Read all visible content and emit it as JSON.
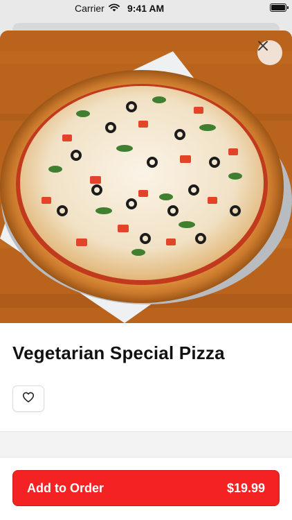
{
  "status_bar": {
    "carrier": "Carrier",
    "time": "9:41 AM",
    "wifi_icon": "wifi-icon",
    "battery_icon": "battery-icon"
  },
  "product": {
    "name": "Vegetarian Special Pizza",
    "image": "pizza-photo"
  },
  "actions": {
    "close_icon": "close-icon",
    "favorite_icon": "heart-outline-icon",
    "add_to_order_label": "Add to Order",
    "price": "$19.99"
  },
  "colors": {
    "accent": "#f42222",
    "text": "#111111"
  }
}
